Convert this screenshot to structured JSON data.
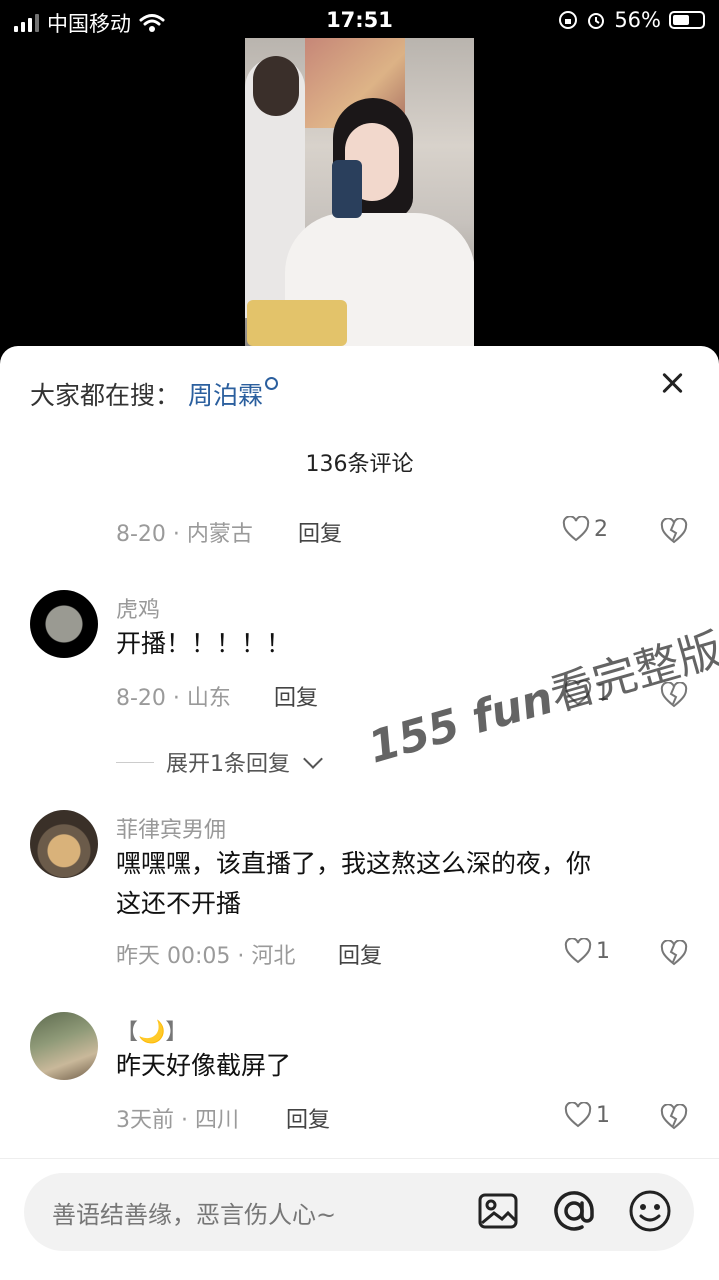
{
  "status_bar": {
    "carrier": "中国移动",
    "time": "17:51",
    "battery": "56%",
    "battery_level": 0.56
  },
  "sheet": {
    "search_prefix": "大家都在搜：",
    "search_term": "周泊霖",
    "comment_count": "136条评论"
  },
  "comments": [
    {
      "meta": "8-20 · 内蒙古",
      "reply": "回复",
      "likes": "2"
    },
    {
      "user": "虎鸡",
      "text": "开播！！！！！",
      "meta": "8-20 · 山东",
      "reply": "回复",
      "likes": "1"
    },
    {
      "user": "菲律宾男佣",
      "text_line1": "嘿嘿嘿，该直播了，我这熬这么深的夜，你",
      "text_line2": "这还不开播",
      "meta": "昨天 00:05 · 河北",
      "reply": "回复",
      "likes": "1"
    },
    {
      "user": "【🌙】",
      "text": "昨天好像截屏了",
      "meta": "3天前 · 四川",
      "reply": "回复",
      "likes": "1"
    }
  ],
  "expand_label": "展开1条回复",
  "watermark": {
    "latin": "155 fun",
    "cn": "看完整版"
  },
  "input": {
    "placeholder": "善语结善缘，恶言伤人心~"
  },
  "icons": [
    "close-icon",
    "search-icon",
    "heart-icon",
    "broken-heart-icon",
    "image-icon",
    "at-icon",
    "emoji-icon",
    "wifi-icon",
    "alarm-icon",
    "battery-icon"
  ]
}
